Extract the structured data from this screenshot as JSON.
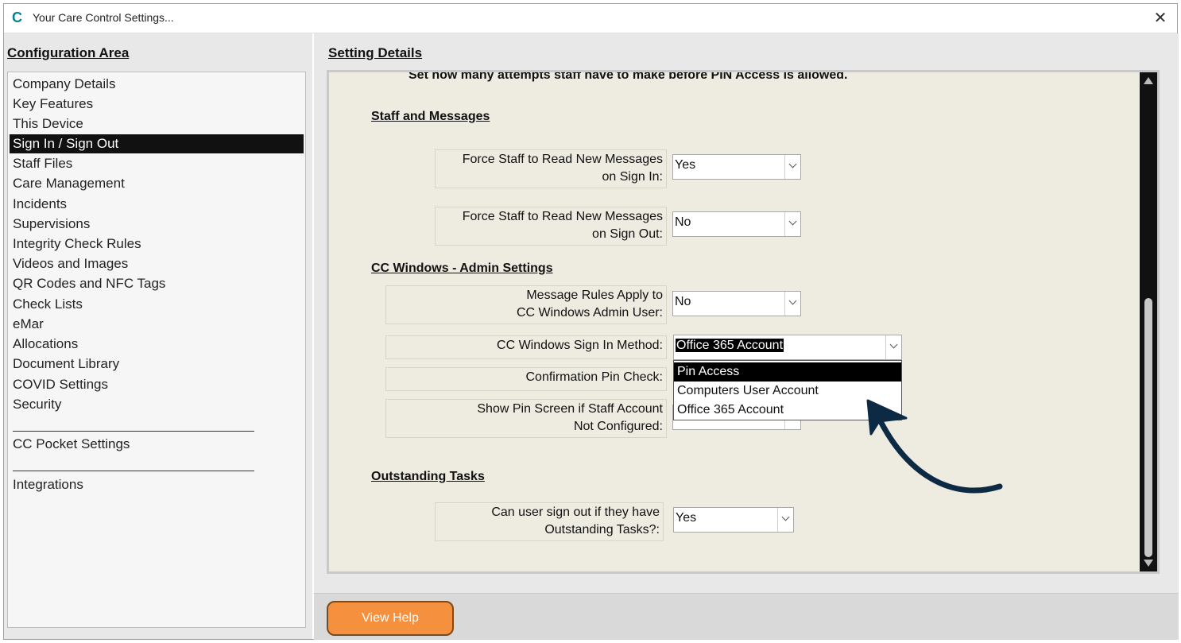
{
  "window": {
    "title": "Your Care Control Settings...",
    "app_icon_glyph": "C",
    "close_glyph": "✕"
  },
  "left": {
    "title": "Configuration Area",
    "items": [
      "Company Details",
      "Key Features",
      "This Device",
      "Sign In / Sign Out",
      "Staff Files",
      "Care Management",
      "Incidents",
      "Supervisions",
      "Integrity Check Rules",
      "Videos and Images",
      "QR Codes and NFC Tags",
      "Check Lists",
      "eMar",
      "Allocations",
      "Document Library",
      "COVID Settings",
      "Security"
    ],
    "active_item": "Sign In / Sign Out",
    "extra_items": [
      "CC Pocket Settings",
      "Integrations"
    ]
  },
  "details": {
    "title": "Setting Details",
    "top_text": "Set how many attempts staff have to make before PIN Access is allowed.",
    "sections": {
      "staff_messages": "Staff and Messages",
      "cc_windows": "CC Windows - Admin Settings",
      "outstanding": "Outstanding Tasks"
    },
    "fields": {
      "force_read_signin": {
        "label_1": "Force Staff to Read New Messages",
        "label_2": "on Sign In:",
        "value": "Yes"
      },
      "force_read_signout": {
        "label_1": "Force Staff to Read New Messages",
        "label_2": "on Sign Out:",
        "value": "No"
      },
      "message_rules": {
        "label_1": "Message Rules Apply to",
        "label_2": "CC Windows Admin User:",
        "value": "No"
      },
      "sign_in_method": {
        "label": "CC Windows Sign In Method:",
        "value": "Office 365 Account"
      },
      "confirmation_pin": {
        "label": "Confirmation Pin Check:"
      },
      "show_pin_screen": {
        "label_1": "Show Pin Screen if Staff Account",
        "label_2": "Not Configured:"
      },
      "outstanding_tasks": {
        "label_1": "Can user sign out if they have",
        "label_2": "Outstanding Tasks?:",
        "value": "Yes"
      }
    },
    "sign_in_method_options": [
      "Pin Access",
      "Computers User Account",
      "Office 365 Account"
    ],
    "highlighted_option": "Pin Access"
  },
  "footer": {
    "help_label": "View Help"
  },
  "colors": {
    "accent_button": "#f5913e",
    "annotation_arrow": "#0d2a45",
    "selection": "#000000"
  }
}
